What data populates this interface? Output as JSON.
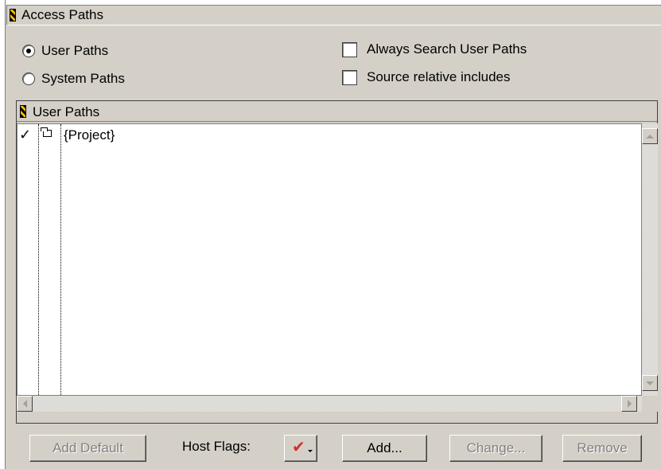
{
  "access_paths": {
    "title": "Access Paths",
    "radio_user_paths": "User Paths",
    "radio_system_paths": "System Paths",
    "selected_radio": "User Paths",
    "check_always_search": "Always Search User Paths",
    "check_source_relative": "Source relative includes"
  },
  "user_paths_list": {
    "title": "User Paths",
    "rows": [
      {
        "checked": "✓",
        "icon": "folder-icon",
        "path": "{Project}"
      }
    ]
  },
  "buttons": {
    "add_default": "Add Default",
    "host_flags_label": "Host Flags:",
    "add": "Add...",
    "change": "Change...",
    "remove": "Remove"
  },
  "icons": {
    "host_flags": "check-mark-icon"
  },
  "colors": {
    "background": "#d4d0c8",
    "list_background": "#ffffff",
    "flag_check": "#d03030",
    "disabled_text": "#808080"
  }
}
